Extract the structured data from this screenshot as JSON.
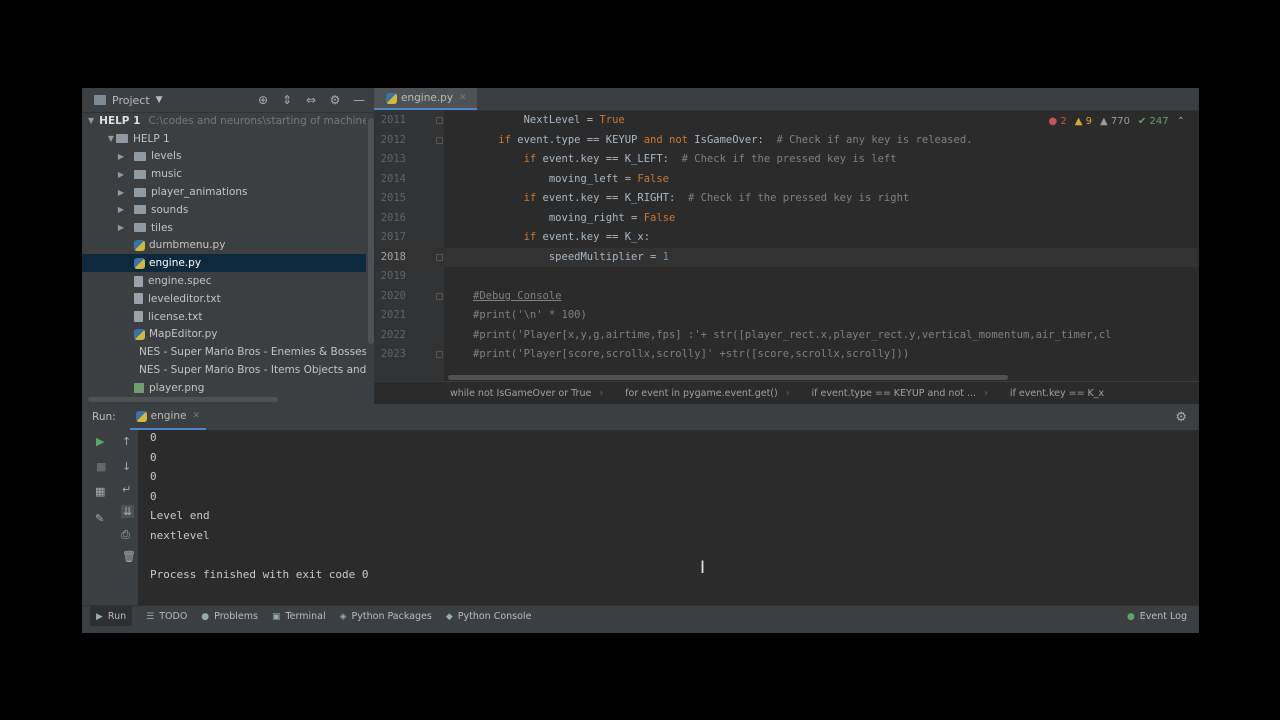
{
  "project_pane": {
    "title": "Project",
    "root_label": "HELP 1",
    "root_path": "C:\\codes and neurons\\starting of machine",
    "folder_label": "HELP 1",
    "items": [
      {
        "label": "levels",
        "kind": "folder"
      },
      {
        "label": "music",
        "kind": "folder"
      },
      {
        "label": "player_animations",
        "kind": "folder"
      },
      {
        "label": "sounds",
        "kind": "folder"
      },
      {
        "label": "tiles",
        "kind": "folder"
      },
      {
        "label": "dumbmenu.py",
        "kind": "py"
      },
      {
        "label": "engine.py",
        "kind": "py",
        "selected": true
      },
      {
        "label": "engine.spec",
        "kind": "file"
      },
      {
        "label": "leveleditor.txt",
        "kind": "file"
      },
      {
        "label": "license.txt",
        "kind": "file"
      },
      {
        "label": "MapEditor.py",
        "kind": "py"
      },
      {
        "label": "NES - Super Mario Bros - Enemies & Bosses.p",
        "kind": "img"
      },
      {
        "label": "NES - Super Mario Bros - Items Objects and N",
        "kind": "img"
      },
      {
        "label": "player.png",
        "kind": "img"
      }
    ]
  },
  "editor": {
    "tab_label": "engine.py",
    "inspections": {
      "errors": "2",
      "warnings": "9",
      "weak": "770",
      "typos": "247"
    },
    "lines": [
      {
        "num": "2011",
        "code": "        NextLevel = True"
      },
      {
        "num": "2012",
        "code": "    if event.type == KEYUP and not IsGameOver:  # Check if any key is released."
      },
      {
        "num": "2013",
        "code": "        if event.key == K_LEFT:  # Check if the pressed key is left"
      },
      {
        "num": "2014",
        "code": "            moving_left = False"
      },
      {
        "num": "2015",
        "code": "        if event.key == K_RIGHT:  # Check if the pressed key is right"
      },
      {
        "num": "2016",
        "code": "            moving_right = False"
      },
      {
        "num": "2017",
        "code": "        if event.key == K_x:"
      },
      {
        "num": "2018",
        "code": "            speedMultiplier = 1"
      },
      {
        "num": "2019",
        "code": ""
      },
      {
        "num": "2020",
        "code": "#Debug Console"
      },
      {
        "num": "2021",
        "code": "#print('\\n' * 100)"
      },
      {
        "num": "2022",
        "code": "#print('Player[x,y,g,airtime,fps] :'+ str([player_rect.x,player_rect.y,vertical_momentum,air_timer,cl"
      },
      {
        "num": "2023",
        "code": "#print('Player[score,scrollx,scrolly]' +str([score,scrollx,scrolly]))"
      }
    ],
    "breadcrumbs": [
      "while not IsGameOver or True",
      "for event in pygame.event.get()",
      "if event.type == KEYUP and not ...",
      "if event.key == K_x"
    ]
  },
  "run_window": {
    "label": "Run:",
    "tab_label": "engine",
    "output": [
      "0",
      "0",
      "0",
      "0",
      "Level end",
      "nextlevel",
      "",
      "Process finished with exit code 0"
    ]
  },
  "bottom_bar": {
    "run": "Run",
    "todo": "TODO",
    "problems": "Problems",
    "terminal": "Terminal",
    "packages": "Python Packages",
    "console": "Python Console",
    "event_log": "Event Log"
  }
}
